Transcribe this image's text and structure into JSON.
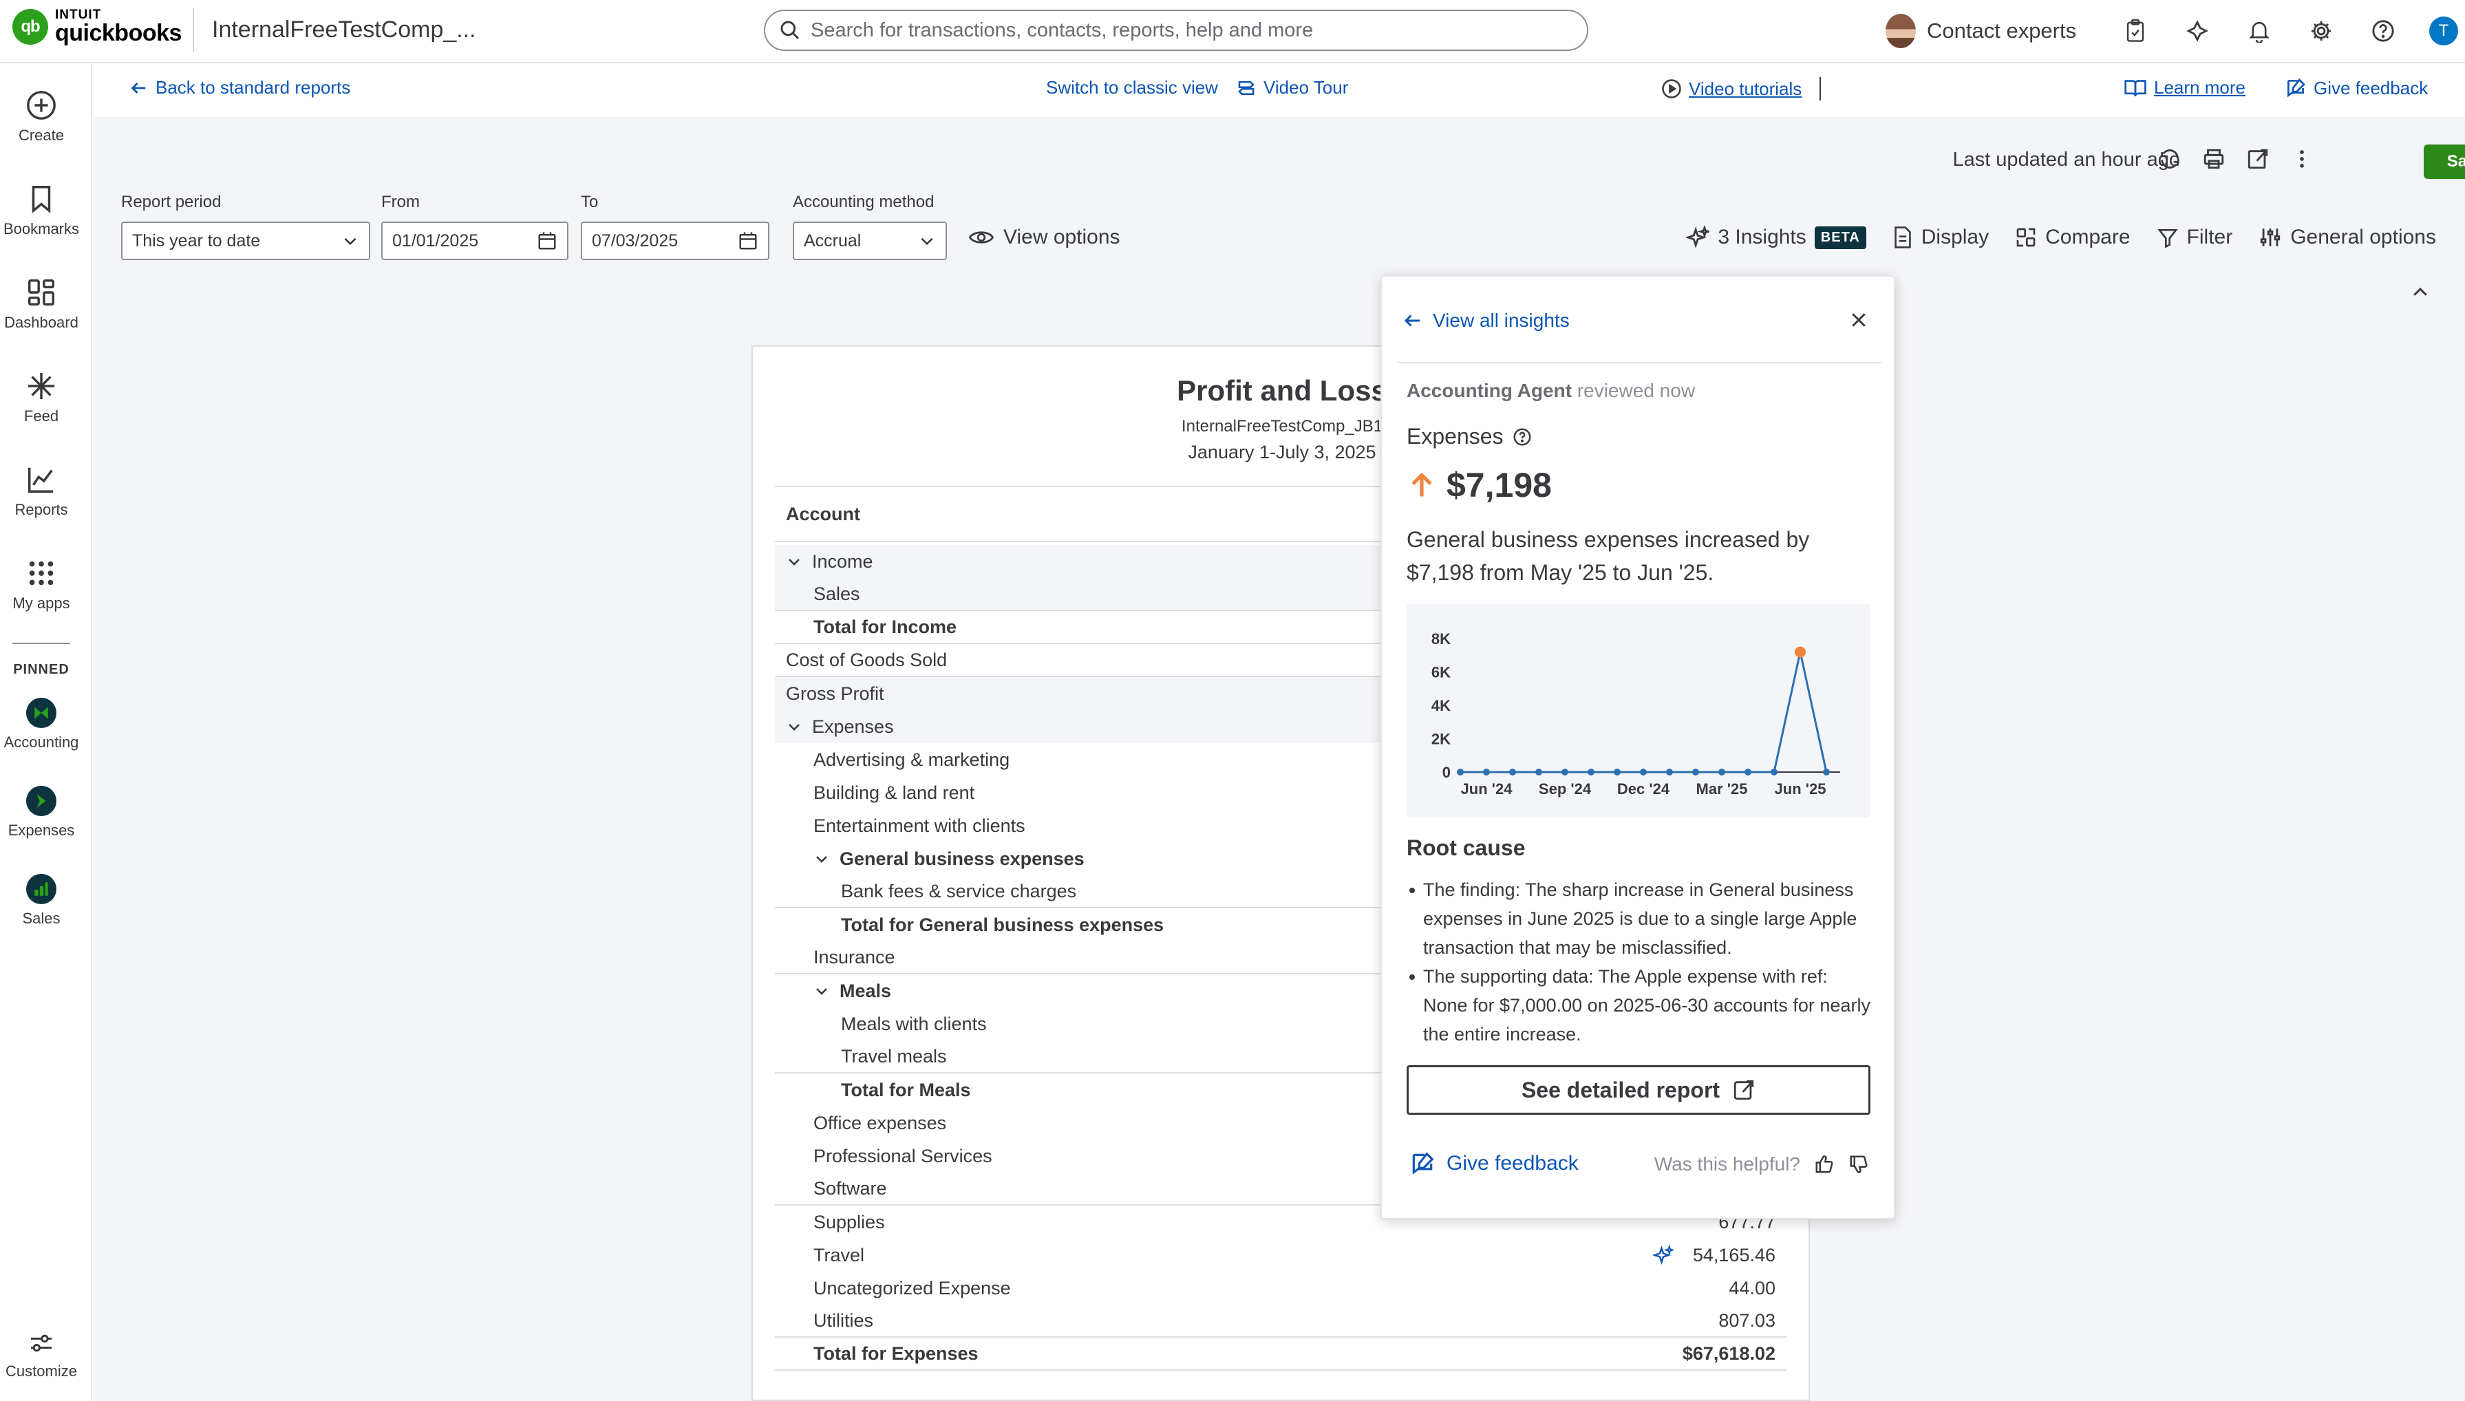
{
  "topbar": {
    "logo_intuit": "INTUIT",
    "logo_product": "quickbooks",
    "company": "InternalFreeTestComp_...",
    "search_placeholder": "Search for transactions, contacts, reports, help and more",
    "contact_experts": "Contact experts",
    "user_initial": "T"
  },
  "nav": {
    "items": [
      {
        "label": "Create",
        "icon": "plus-circle-icon"
      },
      {
        "label": "Bookmarks",
        "icon": "bookmark-icon"
      },
      {
        "label": "Dashboard",
        "icon": "dashboard-icon"
      },
      {
        "label": "Feed",
        "icon": "sparkle-icon"
      },
      {
        "label": "Reports",
        "icon": "line-chart-icon"
      },
      {
        "label": "My apps",
        "icon": "apps-grid-icon"
      }
    ],
    "pinned_label": "PINNED",
    "pinned": [
      {
        "label": "Accounting"
      },
      {
        "label": "Expenses"
      },
      {
        "label": "Sales"
      }
    ],
    "customize": "Customize"
  },
  "subheader": {
    "back": "Back to standard reports",
    "classic": "Switch to classic view",
    "video_tour": "Video Tour",
    "video_tutorials": "Video tutorials",
    "learn_more": "Learn more",
    "give_feedback": "Give feedback"
  },
  "toolbar": {
    "last_updated": "Last updated an hour ago",
    "save_as": "Save As",
    "report_period_label": "Report period",
    "report_period_value": "This year to date",
    "from_label": "From",
    "from_value": "01/01/2025",
    "to_label": "To",
    "to_value": "07/03/2025",
    "method_label": "Accounting method",
    "method_value": "Accrual",
    "view_options": "View options",
    "insights": "3 Insights",
    "beta": "BETA",
    "display": "Display",
    "compare": "Compare",
    "filter": "Filter",
    "general_options": "General options"
  },
  "report": {
    "title": "Profit and Loss",
    "company": "InternalFreeTestComp_JB1",
    "dates": "January 1-July 3, 2025",
    "account_header": "Account",
    "rows": [
      {
        "label": "Income",
        "amount": "",
        "indent": 0,
        "bold": false,
        "chevron": true,
        "shade": true
      },
      {
        "label": "Sales",
        "amount": "",
        "indent": 1,
        "bold": false,
        "shade": true
      },
      {
        "label": "Total for Income",
        "amount": "",
        "indent": 1,
        "bold": true
      },
      {
        "label": "Cost of Goods Sold",
        "amount": "",
        "indent": 0,
        "bold": false
      },
      {
        "label": "Gross Profit",
        "amount": "",
        "indent": 0,
        "bold": false,
        "shade": true
      },
      {
        "label": "Expenses",
        "amount": "",
        "indent": 0,
        "bold": false,
        "chevron": true,
        "shade": true
      },
      {
        "label": "Advertising & marketing",
        "amount": "",
        "indent": 1
      },
      {
        "label": "Building & land rent",
        "amount": "",
        "indent": 1
      },
      {
        "label": "Entertainment with clients",
        "amount": "",
        "indent": 1
      },
      {
        "label": "General business expenses",
        "amount": "",
        "indent": 1,
        "bold": true,
        "chevron": true
      },
      {
        "label": "Bank fees & service charges",
        "amount": "",
        "indent": 2
      },
      {
        "label": "Total for General business expenses",
        "amount": "",
        "indent": 2,
        "bold": true
      },
      {
        "label": "Insurance",
        "amount": "",
        "indent": 1
      },
      {
        "label": "Meals",
        "amount": "",
        "indent": 1,
        "bold": true,
        "chevron": true
      },
      {
        "label": "Meals with clients",
        "amount": "",
        "indent": 2
      },
      {
        "label": "Travel meals",
        "amount": "",
        "indent": 2
      },
      {
        "label": "Total for Meals",
        "amount": "",
        "indent": 2,
        "bold": true
      },
      {
        "label": "Office expenses",
        "amount": "",
        "indent": 1
      },
      {
        "label": "Professional Services",
        "amount": "",
        "indent": 1
      },
      {
        "label": "Software",
        "amount": "",
        "indent": 1
      },
      {
        "label": "Supplies",
        "amount": "677.77",
        "indent": 1
      },
      {
        "label": "Travel",
        "amount": "54,165.46",
        "indent": 1,
        "insight": true
      },
      {
        "label": "Uncategorized Expense",
        "amount": "44.00",
        "indent": 1
      },
      {
        "label": "Utilities",
        "amount": "807.03",
        "indent": 1
      },
      {
        "label": "Total for Expenses",
        "amount": "$67,618.02",
        "indent": 1,
        "bold": true
      }
    ]
  },
  "insight": {
    "view_all": "View all insights",
    "agent": "Accounting Agent",
    "reviewed": "reviewed now",
    "metric": "Expenses",
    "value": "$7,198",
    "description": "General business expenses increased by $7,198 from May '25 to Jun '25.",
    "root_cause_title": "Root cause",
    "root_cause": [
      "The finding: The sharp increase in General business expenses in June 2025 is due to a single large Apple transaction that may be misclassified.",
      "The supporting data: The Apple expense with ref: None for $7,000.00 on 2025-06-30 accounts for nearly the entire increase."
    ],
    "see_report": "See detailed report",
    "give_feedback": "Give feedback",
    "helpful": "Was this helpful?"
  },
  "chart_data": {
    "type": "line",
    "x": [
      "May '24",
      "Jun '24",
      "Jul '24",
      "Aug '24",
      "Sep '24",
      "Oct '24",
      "Nov '24",
      "Dec '24",
      "Jan '25",
      "Feb '25",
      "Mar '25",
      "Apr '25",
      "May '25",
      "Jun '25",
      "Jul '25"
    ],
    "tick_labels": [
      "Jun '24",
      "Sep '24",
      "Dec '24",
      "Mar '25",
      "Jun '25"
    ],
    "tick_positions": [
      1,
      4,
      7,
      10,
      13
    ],
    "y_ticks": [
      "0",
      "2K",
      "4K",
      "6K",
      "8K"
    ],
    "series": [
      {
        "values": [
          0,
          0,
          0,
          0,
          0,
          0,
          0,
          0,
          0,
          0,
          0,
          0,
          0,
          7198,
          0
        ]
      }
    ],
    "highlight_index": 13,
    "ylim": [
      0,
      8000
    ],
    "line_color": "#2d6fb0",
    "highlight_color": "#f0843c",
    "grid": false
  }
}
